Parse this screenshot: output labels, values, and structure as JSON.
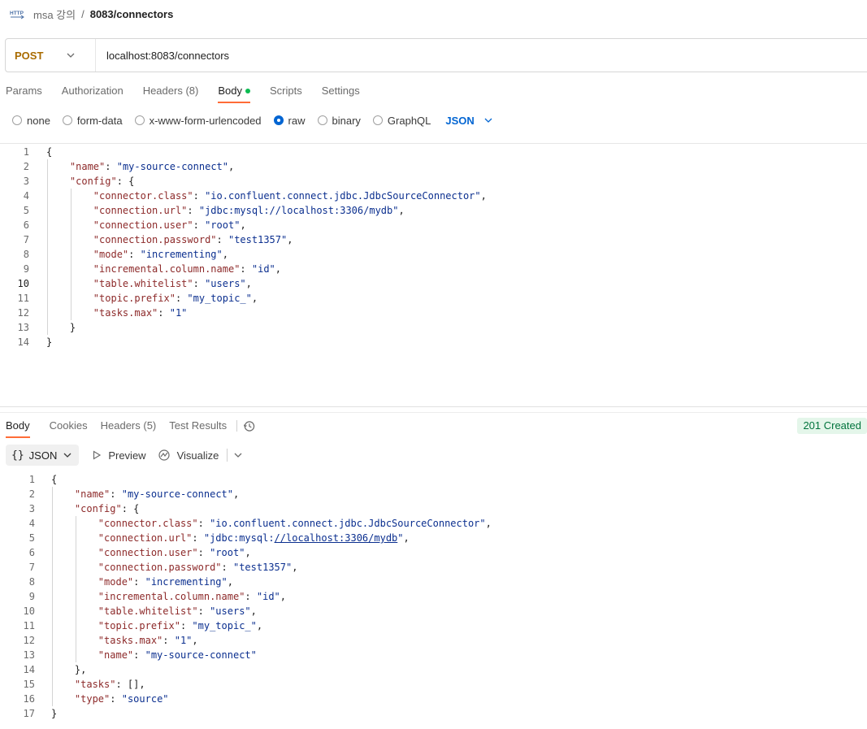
{
  "breadcrumb": {
    "icon": "http-icon",
    "collection": "msa 강의",
    "separator": "/",
    "request": "8083/connectors"
  },
  "request": {
    "method": "POST",
    "url": "localhost:8083/connectors",
    "method_color": "#a96b00"
  },
  "request_tabs": [
    {
      "label": "Params"
    },
    {
      "label": "Authorization"
    },
    {
      "label": "Headers",
      "count": "(8)"
    },
    {
      "label": "Body",
      "active": true
    },
    {
      "label": "Scripts"
    },
    {
      "label": "Settings"
    }
  ],
  "body_types": {
    "options": [
      "none",
      "form-data",
      "x-www-form-urlencoded",
      "raw",
      "binary",
      "GraphQL"
    ],
    "selected": "raw",
    "language": "JSON"
  },
  "request_body": {
    "lines": [
      [
        [
          "p",
          "{"
        ]
      ],
      [
        [
          "p",
          "    "
        ],
        [
          "k",
          "\"name\""
        ],
        [
          "p",
          ": "
        ],
        [
          "s",
          "\"my-source-connect\""
        ],
        [
          "p",
          ","
        ]
      ],
      [
        [
          "p",
          "    "
        ],
        [
          "k",
          "\"config\""
        ],
        [
          "p",
          ": {"
        ]
      ],
      [
        [
          "p",
          "        "
        ],
        [
          "k",
          "\"connector.class\""
        ],
        [
          "p",
          ": "
        ],
        [
          "s",
          "\"io.confluent.connect.jdbc.JdbcSourceConnector\""
        ],
        [
          "p",
          ","
        ]
      ],
      [
        [
          "p",
          "        "
        ],
        [
          "k",
          "\"connection.url\""
        ],
        [
          "p",
          ": "
        ],
        [
          "s",
          "\"jdbc:mysql://localhost:3306/mydb\""
        ],
        [
          "p",
          ","
        ]
      ],
      [
        [
          "p",
          "        "
        ],
        [
          "k",
          "\"connection.user\""
        ],
        [
          "p",
          ": "
        ],
        [
          "s",
          "\"root\""
        ],
        [
          "p",
          ","
        ]
      ],
      [
        [
          "p",
          "        "
        ],
        [
          "k",
          "\"connection.password\""
        ],
        [
          "p",
          ": "
        ],
        [
          "s",
          "\"test1357\""
        ],
        [
          "p",
          ","
        ]
      ],
      [
        [
          "p",
          "        "
        ],
        [
          "k",
          "\"mode\""
        ],
        [
          "p",
          ": "
        ],
        [
          "s",
          "\"incrementing\""
        ],
        [
          "p",
          ","
        ]
      ],
      [
        [
          "p",
          "        "
        ],
        [
          "k",
          "\"incremental.column.name\""
        ],
        [
          "p",
          ": "
        ],
        [
          "s",
          "\"id\""
        ],
        [
          "p",
          ","
        ]
      ],
      [
        [
          "p",
          "        "
        ],
        [
          "k",
          "\"table.whitelist\""
        ],
        [
          "p",
          ": "
        ],
        [
          "s",
          "\"users\""
        ],
        [
          "p",
          ","
        ]
      ],
      [
        [
          "p",
          "        "
        ],
        [
          "k",
          "\"topic.prefix\""
        ],
        [
          "p",
          ": "
        ],
        [
          "s",
          "\"my_topic_\""
        ],
        [
          "p",
          ","
        ]
      ],
      [
        [
          "p",
          "        "
        ],
        [
          "k",
          "\"tasks.max\""
        ],
        [
          "p",
          ": "
        ],
        [
          "s",
          "\"1\""
        ]
      ],
      [
        [
          "p",
          "    }"
        ]
      ],
      [
        [
          "p",
          "}"
        ]
      ]
    ],
    "current_line": 10
  },
  "response_tabs": [
    {
      "label": "Body",
      "active": true
    },
    {
      "label": "Cookies"
    },
    {
      "label": "Headers",
      "count": "(5)"
    },
    {
      "label": "Test Results"
    }
  ],
  "response_status": "201 Created",
  "response_toolbar": {
    "format": "JSON",
    "preview": "Preview",
    "visualize": "Visualize"
  },
  "response_body": {
    "lines": [
      [
        [
          "p",
          "{"
        ]
      ],
      [
        [
          "p",
          "    "
        ],
        [
          "k",
          "\"name\""
        ],
        [
          "p",
          ": "
        ],
        [
          "s",
          "\"my-source-connect\""
        ],
        [
          "p",
          ","
        ]
      ],
      [
        [
          "p",
          "    "
        ],
        [
          "k",
          "\"config\""
        ],
        [
          "p",
          ": {"
        ]
      ],
      [
        [
          "p",
          "        "
        ],
        [
          "k",
          "\"connector.class\""
        ],
        [
          "p",
          ": "
        ],
        [
          "s",
          "\"io.confluent.connect.jdbc.JdbcSourceConnector\""
        ],
        [
          "p",
          ","
        ]
      ],
      [
        [
          "p",
          "        "
        ],
        [
          "k",
          "\"connection.url\""
        ],
        [
          "p",
          ": "
        ],
        [
          "s",
          "\"jdbc:mysql:"
        ],
        [
          "u",
          "//localhost:3306/mydb"
        ],
        [
          "s",
          "\""
        ],
        [
          "p",
          ","
        ]
      ],
      [
        [
          "p",
          "        "
        ],
        [
          "k",
          "\"connection.user\""
        ],
        [
          "p",
          ": "
        ],
        [
          "s",
          "\"root\""
        ],
        [
          "p",
          ","
        ]
      ],
      [
        [
          "p",
          "        "
        ],
        [
          "k",
          "\"connection.password\""
        ],
        [
          "p",
          ": "
        ],
        [
          "s",
          "\"test1357\""
        ],
        [
          "p",
          ","
        ]
      ],
      [
        [
          "p",
          "        "
        ],
        [
          "k",
          "\"mode\""
        ],
        [
          "p",
          ": "
        ],
        [
          "s",
          "\"incrementing\""
        ],
        [
          "p",
          ","
        ]
      ],
      [
        [
          "p",
          "        "
        ],
        [
          "k",
          "\"incremental.column.name\""
        ],
        [
          "p",
          ": "
        ],
        [
          "s",
          "\"id\""
        ],
        [
          "p",
          ","
        ]
      ],
      [
        [
          "p",
          "        "
        ],
        [
          "k",
          "\"table.whitelist\""
        ],
        [
          "p",
          ": "
        ],
        [
          "s",
          "\"users\""
        ],
        [
          "p",
          ","
        ]
      ],
      [
        [
          "p",
          "        "
        ],
        [
          "k",
          "\"topic.prefix\""
        ],
        [
          "p",
          ": "
        ],
        [
          "s",
          "\"my_topic_\""
        ],
        [
          "p",
          ","
        ]
      ],
      [
        [
          "p",
          "        "
        ],
        [
          "k",
          "\"tasks.max\""
        ],
        [
          "p",
          ": "
        ],
        [
          "s",
          "\"1\""
        ],
        [
          "p",
          ","
        ]
      ],
      [
        [
          "p",
          "        "
        ],
        [
          "k",
          "\"name\""
        ],
        [
          "p",
          ": "
        ],
        [
          "s",
          "\"my-source-connect\""
        ]
      ],
      [
        [
          "p",
          "    },"
        ]
      ],
      [
        [
          "p",
          "    "
        ],
        [
          "k",
          "\"tasks\""
        ],
        [
          "p",
          ": [],"
        ]
      ],
      [
        [
          "p",
          "    "
        ],
        [
          "k",
          "\"type\""
        ],
        [
          "p",
          ": "
        ],
        [
          "s",
          "\"source\""
        ]
      ],
      [
        [
          "p",
          "}"
        ]
      ]
    ]
  },
  "colors": {
    "accent_tab": "#ff6c37",
    "link_blue": "#0265d2",
    "json_key": "#8d2a2a",
    "json_string": "#0b2f8f",
    "status_bg": "#e4f6ea",
    "status_text": "#00733c"
  }
}
